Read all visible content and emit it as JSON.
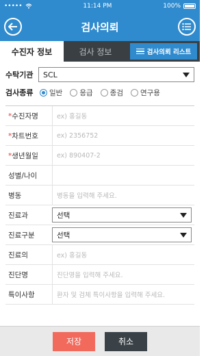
{
  "status_bar": {
    "carrier": "•••••",
    "time": "11:14 PM",
    "battery": "100%"
  },
  "header": {
    "title": "검사의뢰",
    "back_icon": "arrow-left-icon",
    "menu_icon": "list-icon"
  },
  "tabs": [
    {
      "label": "수진자 정보",
      "active": true
    },
    {
      "label": "검사 정보",
      "active": false
    }
  ],
  "list_button": {
    "label": "검사의뢰 리스트"
  },
  "institution": {
    "label": "수탁기관",
    "value": "SCL"
  },
  "exam_type": {
    "label": "검사종류",
    "options": [
      "일반",
      "응급",
      "종검",
      "연구용"
    ],
    "selected": "일반"
  },
  "fields": {
    "name": {
      "label": "수진자명",
      "placeholder": "ex) 홍길동"
    },
    "chart": {
      "label": "차트번호",
      "placeholder": "ex) 2356752"
    },
    "birth": {
      "label": "생년월일",
      "placeholder": "ex) 890407-2"
    },
    "sex_age": {
      "label": "성별/나이",
      "placeholder": ""
    },
    "ward": {
      "label": "병동",
      "placeholder": "병동을 입력해 주세요."
    },
    "dept": {
      "label": "진료과",
      "value": "선택"
    },
    "care_type": {
      "label": "진료구분",
      "value": "선택"
    },
    "doctor": {
      "label": "진료의",
      "placeholder": "ex) 홍길동"
    },
    "diagnosis": {
      "label": "진단명",
      "placeholder": "진단명을 입력해 주세요."
    },
    "notes": {
      "label": "특이사항",
      "placeholder": "환자 및 검체 특이사항을 입력해 주세요."
    }
  },
  "buttons": {
    "save": "저장",
    "cancel": "취소"
  },
  "colors": {
    "primary": "#2f8bce",
    "save": "#f26a5c",
    "cancel": "#3a4248",
    "required": "#e03c3c"
  }
}
